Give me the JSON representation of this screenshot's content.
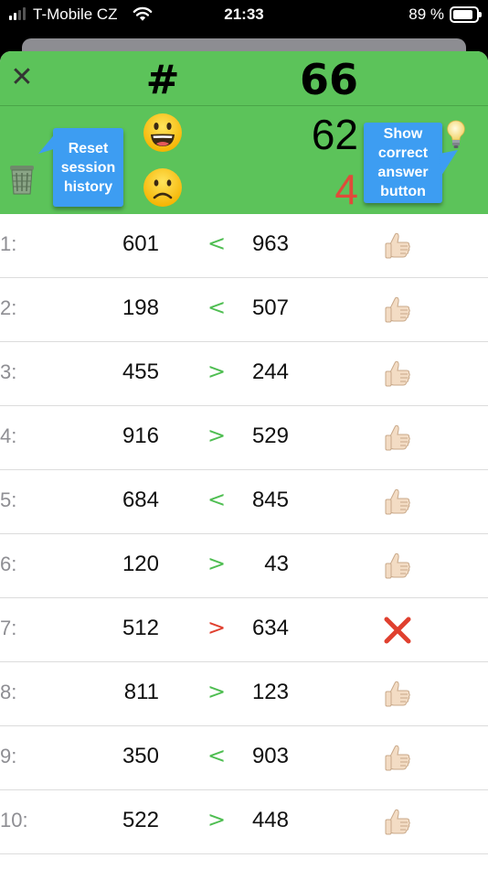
{
  "status_bar": {
    "carrier": "T-Mobile CZ",
    "time": "21:33",
    "battery_percent": "89 %",
    "battery_level": 0.89
  },
  "header": {
    "close_icon": "close-icon",
    "hash_label": "#",
    "total": "66",
    "correct_count": "62",
    "wrong_count": "4",
    "happy_icon": "smiley-icon",
    "sad_icon": "frowning-face-icon",
    "trash_icon": "trash-can-icon",
    "bulb_icon": "light-bulb-icon",
    "reset_tip": "Reset session history",
    "show_tip": "Show correct answer button"
  },
  "colors": {
    "header_bg": "#5cc35a",
    "correct_op": "#4fbe52",
    "wrong_op": "#e0402f",
    "tip_bg": "#3d9df2",
    "wrong_count": "#e04b3a"
  },
  "rows": [
    {
      "index": "1:",
      "a": "601",
      "op": "<",
      "b": "963",
      "result": "thumbs-up"
    },
    {
      "index": "2:",
      "a": "198",
      "op": "<",
      "b": "507",
      "result": "thumbs-up"
    },
    {
      "index": "3:",
      "a": "455",
      "op": ">",
      "b": "244",
      "result": "thumbs-up"
    },
    {
      "index": "4:",
      "a": "916",
      "op": ">",
      "b": "529",
      "result": "thumbs-up"
    },
    {
      "index": "5:",
      "a": "684",
      "op": "<",
      "b": "845",
      "result": "thumbs-up"
    },
    {
      "index": "6:",
      "a": "120",
      "op": ">",
      "b": "43",
      "result": "thumbs-up"
    },
    {
      "index": "7:",
      "a": "512",
      "op": ">",
      "b": "634",
      "result": "cross"
    },
    {
      "index": "8:",
      "a": "811",
      "op": ">",
      "b": "123",
      "result": "thumbs-up"
    },
    {
      "index": "9:",
      "a": "350",
      "op": "<",
      "b": "903",
      "result": "thumbs-up"
    },
    {
      "index": "10:",
      "a": "522",
      "op": ">",
      "b": "448",
      "result": "thumbs-up"
    }
  ]
}
